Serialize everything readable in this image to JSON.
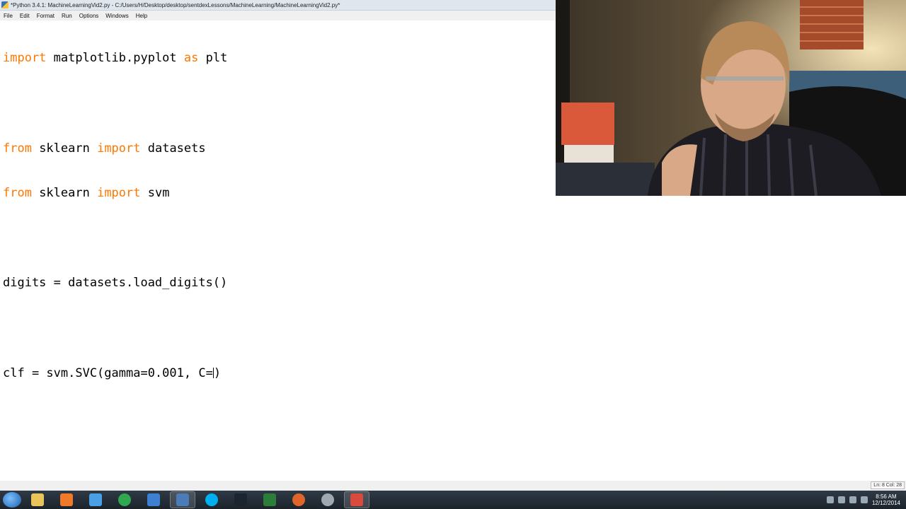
{
  "window": {
    "title": "*Python 3.4.1: MachineLearningVid2.py - C:/Users/H/Desktop/desktop/sentdexLessons/MachineLearning/MachineLearningVid2.py*"
  },
  "menu": {
    "items": [
      "File",
      "Edit",
      "Format",
      "Run",
      "Options",
      "Windows",
      "Help"
    ]
  },
  "editor": {
    "lines": [
      {
        "kw1": "import",
        "t1": " matplotlib.pyplot ",
        "kw2": "as",
        "t2": " plt"
      },
      {
        "kw1": "",
        "t1": "",
        "kw2": "",
        "t2": ""
      },
      {
        "kw1": "from",
        "t1": " sklearn ",
        "kw2": "import",
        "t2": " datasets"
      },
      {
        "kw1": "from",
        "t1": " sklearn ",
        "kw2": "import",
        "t2": " svm"
      },
      {
        "kw1": "",
        "t1": "",
        "kw2": "",
        "t2": ""
      },
      {
        "kw1": "",
        "t1": "digits = datasets.load_digits()",
        "kw2": "",
        "t2": ""
      },
      {
        "kw1": "",
        "t1": "",
        "kw2": "",
        "t2": ""
      },
      {
        "kw1": "",
        "t1": "clf = svm.SVC(gamma=0.001, C=",
        "kw2": "",
        "t2": ")"
      }
    ]
  },
  "statusbar": {
    "position": "Ln: 8 Col: 28"
  },
  "taskbar": {
    "clock_time": "8:56 AM",
    "clock_date": "12/12/2014",
    "apps": [
      {
        "name": "explorer-icon",
        "color": "#e9c45a"
      },
      {
        "name": "media-player-icon",
        "color": "#f07a2a"
      },
      {
        "name": "notepad-icon",
        "color": "#4aa0e6"
      },
      {
        "name": "chrome-icon",
        "color": "#2fa84f"
      },
      {
        "name": "editor-icon",
        "color": "#3d7fd1"
      },
      {
        "name": "python-file-icon",
        "color": "#4b7cb8"
      },
      {
        "name": "skype-icon",
        "color": "#00aff0"
      },
      {
        "name": "app-v-icon",
        "color": "#1b2530"
      },
      {
        "name": "terminal-icon",
        "color": "#2c7d3a"
      },
      {
        "name": "firefox-icon",
        "color": "#e0652b"
      },
      {
        "name": "settings-icon",
        "color": "#a0a8b0"
      },
      {
        "name": "python-idle-icon",
        "color": "#d84a3c"
      }
    ]
  }
}
